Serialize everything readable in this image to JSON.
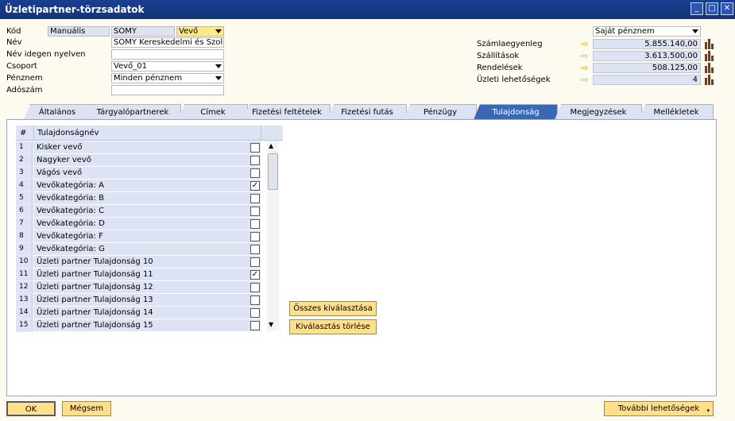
{
  "window": {
    "title": "Üzletipartner-törzsadatok"
  },
  "header": {
    "kod_label": "Kód",
    "kod_mode": "Manuális",
    "kod_value": "SOMY",
    "type_value": "Vevő",
    "nev_label": "Név",
    "nev_value": "SOMY Kereskedelmi és Szolgálta",
    "nev_idegen_label": "Név idegen nyelven",
    "nev_idegen_value": "",
    "csoport_label": "Csoport",
    "csoport_value": "Vevő_01",
    "penznem_label": "Pénznem",
    "penznem_value": "Minden pénznem",
    "adoszam_label": "Adószám",
    "adoszam_value": ""
  },
  "summary": {
    "currency_value": "Saját pénznem",
    "rows": [
      {
        "label": "Számlaegyenleg",
        "value": "5.855.140,00"
      },
      {
        "label": "Szállítások",
        "value": "3.613.500,00"
      },
      {
        "label": "Rendelések",
        "value": "508.125,00"
      },
      {
        "label": "Üzleti lehetőségek",
        "value": "4"
      }
    ]
  },
  "tabs": [
    {
      "label": "Általános"
    },
    {
      "label": "Tárgyalópartnerek"
    },
    {
      "label": "Címek"
    },
    {
      "label": "Fizetési feltételek"
    },
    {
      "label": "Fizetési futás"
    },
    {
      "label": "Pénzügy"
    },
    {
      "label": "Tulajdonság"
    },
    {
      "label": "Megjegyzések"
    },
    {
      "label": "Mellékletek"
    }
  ],
  "grid": {
    "col_num": "#",
    "col_name": "Tulajdonságnév",
    "rows": [
      {
        "num": "1",
        "name": "Kisker vevő",
        "checked": false
      },
      {
        "num": "2",
        "name": "Nagyker vevő",
        "checked": false
      },
      {
        "num": "3",
        "name": "Vágós vevő",
        "checked": false
      },
      {
        "num": "4",
        "name": "Vevőkategória: A",
        "checked": true
      },
      {
        "num": "5",
        "name": "Vevőkategória: B",
        "checked": false
      },
      {
        "num": "6",
        "name": "Vevőkategória: C",
        "checked": false
      },
      {
        "num": "7",
        "name": "Vevőkategória: D",
        "checked": false
      },
      {
        "num": "8",
        "name": "Vevőkategória: F",
        "checked": false
      },
      {
        "num": "9",
        "name": "Vevőkategória: G",
        "checked": false
      },
      {
        "num": "10",
        "name": "Üzleti partner Tulajdonság 10",
        "checked": false
      },
      {
        "num": "11",
        "name": "Üzleti partner Tulajdonság 11",
        "checked": true
      },
      {
        "num": "12",
        "name": "Üzleti partner Tulajdonság 12",
        "checked": false
      },
      {
        "num": "13",
        "name": "Üzleti partner Tulajdonság 13",
        "checked": false
      },
      {
        "num": "14",
        "name": "Üzleti partner Tulajdonság 14",
        "checked": false
      },
      {
        "num": "15",
        "name": "Üzleti partner Tulajdonság 15",
        "checked": false
      }
    ]
  },
  "actions": {
    "select_all": "Összes kiválasztása",
    "clear_selection": "Kiválasztás törlése"
  },
  "footer": {
    "ok": "OK",
    "cancel": "Mégsem",
    "more": "További lehetőségek"
  },
  "colors": {
    "accent": "#3968b7",
    "title_bg": "#1a3f91",
    "button_bg": "#ffe08a"
  }
}
